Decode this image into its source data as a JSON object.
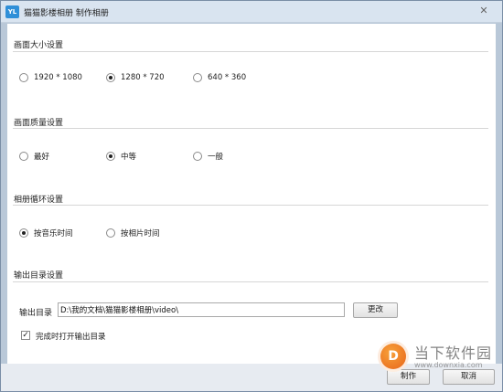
{
  "window": {
    "app_icon_text": "YL",
    "title": "猫猫影楼相册 制作相册",
    "close_glyph": "✕"
  },
  "sections": {
    "size": {
      "title": "画面大小设置",
      "options": [
        "1920 * 1080",
        "1280 * 720",
        "640 * 360"
      ],
      "selected": "1280 * 720"
    },
    "quality": {
      "title": "画面质量设置",
      "options": [
        "最好",
        "中等",
        "一般"
      ],
      "selected": "中等"
    },
    "loop": {
      "title": "相册循环设置",
      "options": [
        "按音乐时间",
        "按相片时间"
      ],
      "selected": "按音乐时间"
    },
    "output": {
      "title": "输出目录设置",
      "dir_label": "输出目录",
      "path_value": "D:\\我的文档\\猫猫影楼相册\\video\\",
      "change_label": "更改",
      "open_checkbox_label": "完成时打开输出目录",
      "open_checked": true
    }
  },
  "footer": {
    "make_label": "制作",
    "cancel_label": "取消"
  },
  "watermark": {
    "logo_text": "D",
    "name": "当下软件园",
    "url": "www.downxia.com"
  },
  "colors": {
    "titlebar": "#d9e4f0",
    "frame": "#b9c8d8",
    "watermark_orange": "#e8651a"
  }
}
